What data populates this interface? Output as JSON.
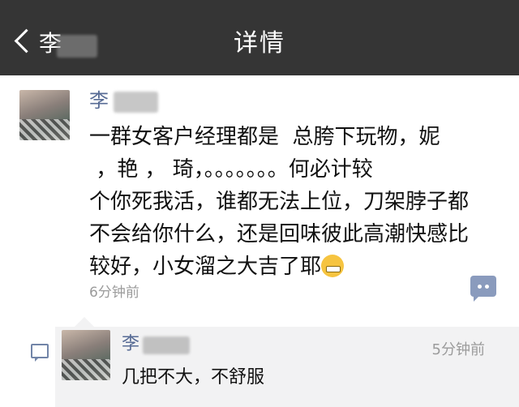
{
  "header": {
    "back_label": "李",
    "title": "详情"
  },
  "post": {
    "author": "李",
    "text": "一群女客户经理都是  总胯下玩物，妮\n ，艳 ， 琦，。。。。。。。何必计较\n个你死我活，谁都无法上位，刀架脖子都\n不会给你什么，还是回味彼此高潮快感比\n较好，小女溜之大吉了耶",
    "time": "6分钟前",
    "emoji": "grimacing-emoji"
  },
  "reply": {
    "author": "李",
    "time": "5分钟前",
    "text": "几把不大，不舒服"
  },
  "icons": {
    "back": "chevron-left-icon",
    "comment": "comment-icon",
    "speech": "speech-bubble-icon"
  },
  "colors": {
    "header_bg": "#353535",
    "link": "#576b95",
    "comment_button": "#8a9bbd",
    "reply_bg": "#f2f2f3"
  }
}
